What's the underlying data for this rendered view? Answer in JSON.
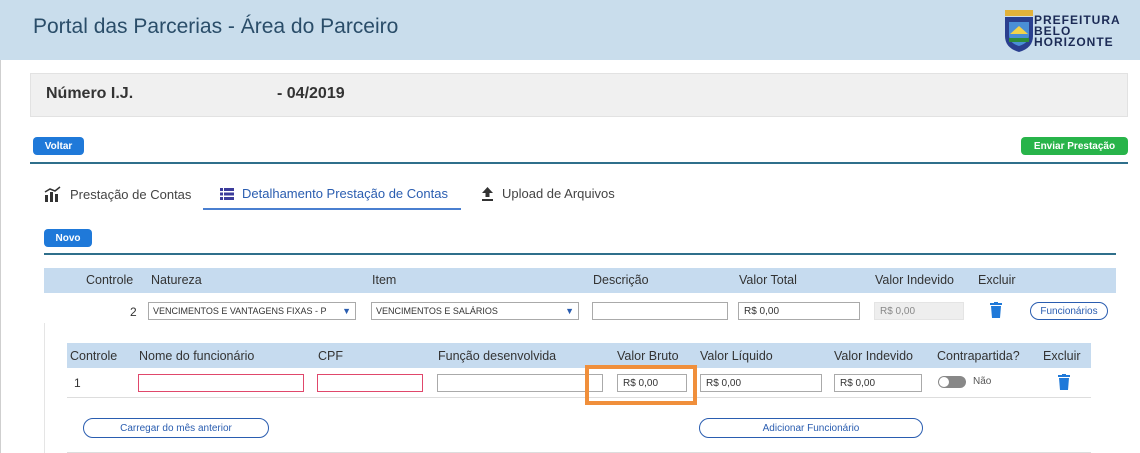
{
  "header": {
    "title": "Portal das Parcerias - Área do Parceiro",
    "logo_line1": "PREFEITURA",
    "logo_line2": "BELO HORIZONTE"
  },
  "ij": {
    "label": "Número I.J.",
    "value": "- 04/2019"
  },
  "buttons": {
    "voltar": "Voltar",
    "enviar": "Enviar Prestação",
    "novo": "Novo",
    "funcionarios": "Funcionários",
    "carregar": "Carregar do mês anterior",
    "adicionar": "Adicionar Funcionário"
  },
  "tabs": [
    {
      "label": "Prestação de Contas",
      "icon": "chart-icon"
    },
    {
      "label": "Detalhamento Prestação de Contas",
      "icon": "list-icon",
      "active": true
    },
    {
      "label": "Upload de Arquivos",
      "icon": "upload-icon"
    }
  ],
  "table1": {
    "headers": [
      "Controle",
      "Natureza",
      "Item",
      "Descrição",
      "Valor Total",
      "Valor Indevido",
      "Excluir"
    ],
    "row": {
      "controle": "2",
      "natureza": "VENCIMENTOS E VANTAGENS FIXAS - P",
      "item": "VENCIMENTOS E SALÁRIOS",
      "descricao": "",
      "valor_total": "R$ 0,00",
      "valor_indevido": "R$ 0,00"
    }
  },
  "table2": {
    "headers": [
      "Controle",
      "Nome do funcionário",
      "CPF",
      "Função desenvolvida",
      "Valor Bruto",
      "Valor Líquido",
      "Valor Indevido",
      "Contrapartida?",
      "Excluir"
    ],
    "row": {
      "controle": "1",
      "nome": "",
      "cpf": "",
      "funcao": "",
      "valor_bruto": "R$ 0,00",
      "valor_liquido": "R$ 0,00",
      "valor_indevido": "R$ 0,00",
      "contrapartida": "Não"
    }
  },
  "colors": {
    "primary": "#1f79d9",
    "success": "#28b44a",
    "header_bg": "#c9ddec",
    "table_head": "#c6dbef",
    "highlight": "#f08f3b",
    "delete": "#1f79d9"
  }
}
